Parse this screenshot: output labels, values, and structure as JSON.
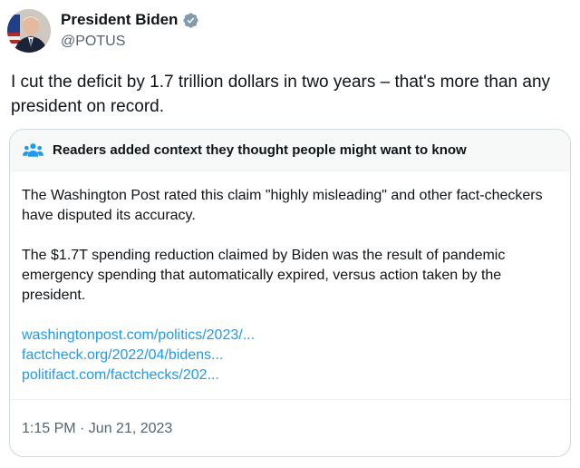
{
  "author": {
    "name": "President Biden",
    "handle": "@POTUS",
    "verified_color": "#829aab",
    "avatar_icon": "presidential-portrait"
  },
  "tweet": {
    "text": "I cut the deficit by 1.7 trillion dollars in two years – that's more than any president on record."
  },
  "community_note": {
    "icon": "people-icon",
    "accent_color": "#1d9bf0",
    "header": "Readers added context they thought people might want to know",
    "paragraph_1": "The Washington Post rated this claim \"highly misleading\" and other fact-checkers have disputed its accuracy.",
    "paragraph_2": "The $1.7T spending reduction claimed by Biden was the result of pandemic emergency spending that automatically expired, versus action taken by the president.",
    "links": [
      "washingtonpost.com/politics/2023/...",
      "factcheck.org/2022/04/bidens...",
      "politifact.com/factchecks/202..."
    ],
    "timestamp": "1:15 PM · Jun 21, 2023"
  }
}
